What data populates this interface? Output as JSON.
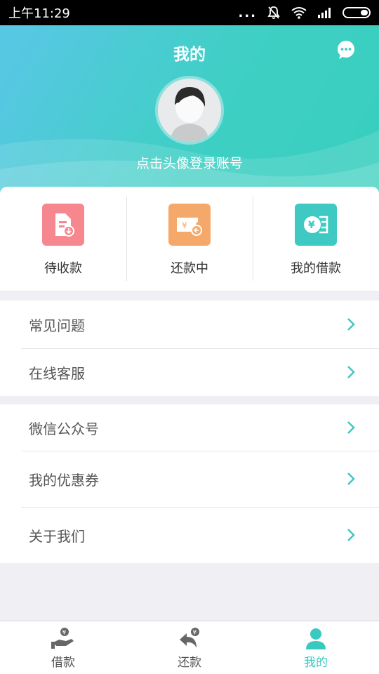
{
  "status_bar": {
    "time": "上午11:29",
    "dots": "..."
  },
  "header": {
    "title": "我的",
    "login_hint": "点击头像登录账号"
  },
  "quick_tiles": [
    {
      "label": "待收款",
      "icon": "document-receive-icon",
      "color": "#f6878f"
    },
    {
      "label": "还款中",
      "icon": "ticket-repay-icon",
      "color": "#f4a96a"
    },
    {
      "label": "我的借款",
      "icon": "yen-coin-icon",
      "color": "#3ecac2"
    }
  ],
  "menu_groups": [
    {
      "items": [
        {
          "label": "常见问题"
        },
        {
          "label": "在线客服"
        }
      ]
    },
    {
      "items": [
        {
          "label": "微信公众号"
        },
        {
          "label": "我的优惠券"
        },
        {
          "label": "关于我们"
        }
      ]
    }
  ],
  "tabbar": {
    "tabs": [
      {
        "label": "借款",
        "active": false
      },
      {
        "label": "还款",
        "active": false
      },
      {
        "label": "我的",
        "active": true
      }
    ]
  },
  "colors": {
    "accent": "#38c9c0",
    "header_start": "#59c7e6",
    "header_end": "#37cfbe",
    "chevron": "#45c5c2",
    "page_bg": "#efeff4"
  }
}
